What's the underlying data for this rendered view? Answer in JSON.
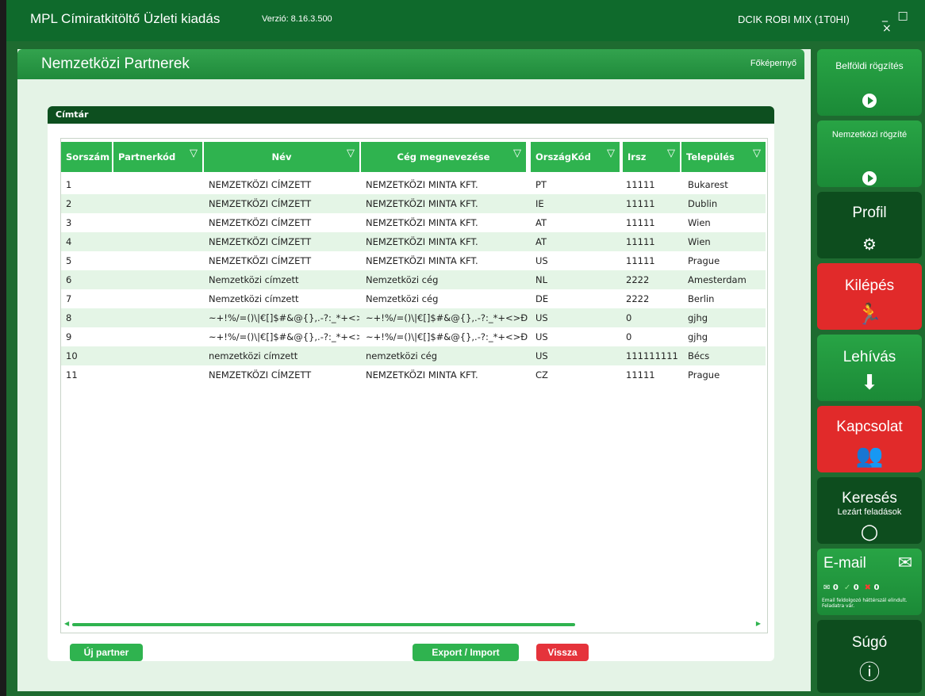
{
  "app": {
    "title": "MPL Címiratkitöltő Üzleti kiadás",
    "version": "Verzió: 8.16.3.500",
    "user": "DCIK ROBI MIX (1T0HI)",
    "window_controls": "_ □ ×"
  },
  "page": {
    "title": "Nemzetközi Partnerek",
    "home_link": "Főképernyő",
    "card_title": "Címtár"
  },
  "table": {
    "columns": [
      "Sorszám",
      "Partnerkód",
      "Név",
      "Cég megnevezése",
      "OrszágKód",
      "Irsz",
      "Település"
    ],
    "filter_icon": "filter-icon",
    "rows": [
      {
        "sorszam": "1",
        "partnerkod": "",
        "nev": "NEMZETKÖZI CÍMZETT",
        "ceg": "NEMZETKÖZI MINTA KFT.",
        "orszag": "PT",
        "irsz": "11111",
        "telepules": "Bukarest"
      },
      {
        "sorszam": "2",
        "partnerkod": "",
        "nev": "NEMZETKÖZI CÍMZETT",
        "ceg": "NEMZETKÖZI MINTA KFT.",
        "orszag": "IE",
        "irsz": "11111",
        "telepules": "Dublin"
      },
      {
        "sorszam": "3",
        "partnerkod": "",
        "nev": "NEMZETKÖZI CÍMZETT",
        "ceg": "NEMZETKÖZI MINTA KFT.",
        "orszag": "AT",
        "irsz": "11111",
        "telepules": "Wien"
      },
      {
        "sorszam": "4",
        "partnerkod": "",
        "nev": "NEMZETKÖZI CÍMZETT",
        "ceg": "NEMZETKÖZI MINTA KFT.",
        "orszag": "AT",
        "irsz": "11111",
        "telepules": "Wien"
      },
      {
        "sorszam": "5",
        "partnerkod": "",
        "nev": "NEMZETKÖZI CÍMZETT",
        "ceg": "NEMZETKÖZI MINTA KFT.",
        "orszag": "US",
        "irsz": "11111",
        "telepules": "Prague"
      },
      {
        "sorszam": "6",
        "partnerkod": "",
        "nev": "Nemzetközi címzett",
        "ceg": "Nemzetközi cég",
        "orszag": "NL",
        "irsz": "2222",
        "telepules": "Amesterdam"
      },
      {
        "sorszam": "7",
        "partnerkod": "",
        "nev": "Nemzetközi címzett",
        "ceg": "Nemzetközi cég",
        "orszag": "DE",
        "irsz": "2222",
        "telepules": "Berlin"
      },
      {
        "sorszam": "8",
        "partnerkod": "",
        "nev": "~+!%/=()\\|€[]$#&@{},.-?:_*+<>",
        "ceg": "~+!%/=()\\|€[]$#&@{},.-?:_*+<>Đđ",
        "orszag": "US",
        "irsz": "0",
        "telepules": "gjhg"
      },
      {
        "sorszam": "9",
        "partnerkod": "",
        "nev": "~+!%/=()\\|€[]$#&@{},.-?:_*+<>",
        "ceg": "~+!%/=()\\|€[]$#&@{},.-?:_*+<>Đđ",
        "orszag": "US",
        "irsz": "0",
        "telepules": "gjhg"
      },
      {
        "sorszam": "10",
        "partnerkod": "",
        "nev": "nemzetközi címzett",
        "ceg": "nemzetközi cég",
        "orszag": "US",
        "irsz": "111111111",
        "telepules": "Bécs"
      },
      {
        "sorszam": "11",
        "partnerkod": "",
        "nev": "NEMZETKÖZI CÍMZETT",
        "ceg": "NEMZETKÖZI MINTA KFT.",
        "orszag": "CZ",
        "irsz": "11111",
        "telepules": "Prague"
      }
    ]
  },
  "buttons": {
    "new_partner": "Új partner",
    "export_import": "Export / Import",
    "back": "Vissza"
  },
  "sidebar": {
    "domestic": "Belföldi rögzítés",
    "international": "Nemzetközi rögzíté",
    "profile": "Profil",
    "logout": "Kilépés",
    "download": "Lehívás",
    "contact": "Kapcsolat",
    "search": "Keresés",
    "search_sub": "Lezárt feladások",
    "email": "E-mail",
    "email_count_sent": "0",
    "email_count_ok": "0",
    "email_count_err": "0",
    "email_note": "Email feldolgozó háttérszál elindult. Feladatra vár.",
    "help": "Súgó"
  },
  "colors": {
    "header_green": "#2fb34f",
    "dark_green": "#0d4f1f",
    "alert_red": "#e12a2a"
  }
}
